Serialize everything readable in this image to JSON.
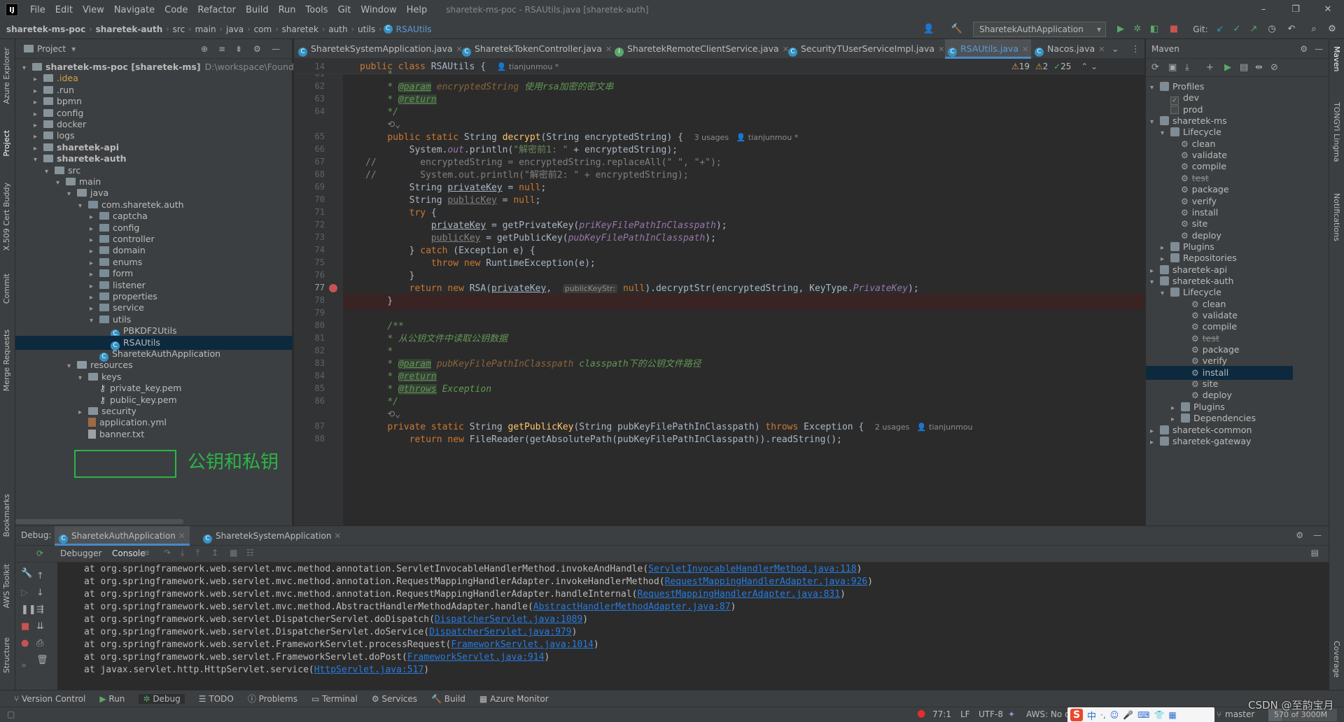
{
  "menubar": {
    "items": [
      "File",
      "Edit",
      "View",
      "Navigate",
      "Code",
      "Refactor",
      "Build",
      "Run",
      "Tools",
      "Git",
      "Window",
      "Help"
    ],
    "title": "sharetek-ms-poc - RSAUtils.java [sharetek-auth]"
  },
  "navbar": {
    "breadcrumbs": [
      "sharetek-ms-poc",
      "sharetek-auth",
      "src",
      "main",
      "java",
      "com",
      "sharetek",
      "auth",
      "utils",
      "RSAUtils"
    ],
    "run_config": "SharetekAuthApplication",
    "git_label": "Git:"
  },
  "left_strip": [
    "Azure Explorer",
    "Project",
    "X.509 Cert Buddy",
    "Commit",
    "Merge Requests",
    "Bookmarks",
    "AWS Toolkit",
    "Structure"
  ],
  "right_strip": [
    "Maven",
    "TONGYI Lingma",
    "Notifications",
    "Coverage"
  ],
  "project": {
    "header": "Project",
    "rows": [
      {
        "label": "sharetek-ms-poc [sharetek-ms]",
        "extra": "D:\\workspace\\Foundation\\s",
        "kind": "folder",
        "bold": true,
        "arrow": "▾"
      },
      {
        "label": ".idea",
        "kind": "folder",
        "arrow": "▸",
        "color": "#d0a248"
      },
      {
        "label": ".run",
        "kind": "folder",
        "arrow": "▸"
      },
      {
        "label": "bpmn",
        "kind": "folder",
        "arrow": "▸"
      },
      {
        "label": "config",
        "kind": "folder",
        "arrow": "▸"
      },
      {
        "label": "docker",
        "kind": "folder",
        "arrow": "▸"
      },
      {
        "label": "logs",
        "kind": "folder",
        "arrow": "▸"
      },
      {
        "label": "sharetek-api",
        "kind": "folder",
        "arrow": "▸",
        "bold": true
      },
      {
        "label": "sharetek-auth",
        "kind": "folder",
        "arrow": "▾",
        "bold": true
      },
      {
        "label": "src",
        "kind": "folder",
        "arrow": "▾"
      },
      {
        "label": "main",
        "kind": "folder",
        "arrow": "▾"
      },
      {
        "label": "java",
        "kind": "folder",
        "arrow": "▾"
      },
      {
        "label": "com.sharetek.auth",
        "kind": "pkg",
        "arrow": "▾"
      },
      {
        "label": "captcha",
        "kind": "pkg",
        "arrow": "▸"
      },
      {
        "label": "config",
        "kind": "pkg",
        "arrow": "▸"
      },
      {
        "label": "controller",
        "kind": "pkg",
        "arrow": "▸"
      },
      {
        "label": "domain",
        "kind": "pkg",
        "arrow": "▸"
      },
      {
        "label": "enums",
        "kind": "pkg",
        "arrow": "▸"
      },
      {
        "label": "form",
        "kind": "pkg",
        "arrow": "▸"
      },
      {
        "label": "listener",
        "kind": "pkg",
        "arrow": "▸"
      },
      {
        "label": "properties",
        "kind": "pkg",
        "arrow": "▸"
      },
      {
        "label": "service",
        "kind": "pkg",
        "arrow": "▸"
      },
      {
        "label": "utils",
        "kind": "pkg",
        "arrow": "▾"
      },
      {
        "label": "PBKDF2Utils",
        "kind": "java",
        "arrow": ""
      },
      {
        "label": "RSAUtils",
        "kind": "java",
        "arrow": "",
        "selected": true
      },
      {
        "label": "SharetekAuthApplication",
        "kind": "java",
        "arrow": ""
      },
      {
        "label": "resources",
        "kind": "res",
        "arrow": "▾"
      },
      {
        "label": "keys",
        "kind": "folder",
        "arrow": "▾"
      },
      {
        "label": "private_key.pem",
        "kind": "key",
        "arrow": ""
      },
      {
        "label": "public_key.pem",
        "kind": "key",
        "arrow": ""
      },
      {
        "label": "security",
        "kind": "folder",
        "arrow": "▸"
      },
      {
        "label": "application.yml",
        "kind": "yml",
        "arrow": ""
      },
      {
        "label": "banner.txt",
        "kind": "txt",
        "arrow": ""
      }
    ],
    "annotation": "公钥和私钥"
  },
  "editor": {
    "tabs": [
      {
        "label": "SharetekSystemApplication.java",
        "active": false
      },
      {
        "label": "SharetekTokenController.java",
        "active": false
      },
      {
        "label": "SharetekRemoteClientService.java",
        "active": false
      },
      {
        "label": "SecurityTUserServiceImpl.java",
        "active": false
      },
      {
        "label": "RSAUtils.java",
        "active": true
      },
      {
        "label": "Nacos.java",
        "active": false
      }
    ],
    "sticky": {
      "line": "14",
      "author": "tianjunmou *"
    },
    "inspections": {
      "warnings": "19",
      "weak": "2",
      "ok": "25"
    },
    "line_numbers": [
      "61",
      "62",
      "63",
      "64",
      "",
      "65",
      "66",
      "67",
      "68",
      "69",
      "70",
      "71",
      "72",
      "73",
      "74",
      "75",
      "76",
      "77",
      "78",
      "79",
      "80",
      "81",
      "82",
      "83",
      "84",
      "85",
      "86",
      "",
      "87",
      "88"
    ],
    "usages_65": "3 usages",
    "author_65": "tianjunmou *",
    "usages_87": "2 usages",
    "author_87": "tianjunmou",
    "inlay_hint": "publicKeyStr:"
  },
  "maven": {
    "header": "Maven",
    "rows": [
      {
        "label": "Profiles",
        "kind": "mvn",
        "arrow": "▾",
        "indent": 0
      },
      {
        "label": "dev",
        "kind": "check",
        "checked": true,
        "indent": 1
      },
      {
        "label": "prod",
        "kind": "check",
        "checked": false,
        "indent": 1
      },
      {
        "label": "sharetek-ms",
        "kind": "mvn",
        "arrow": "▾",
        "indent": 0
      },
      {
        "label": "Lifecycle",
        "kind": "mvn",
        "arrow": "▾",
        "indent": 1
      },
      {
        "label": "clean",
        "kind": "gear",
        "indent": 2
      },
      {
        "label": "validate",
        "kind": "gear",
        "indent": 2
      },
      {
        "label": "compile",
        "kind": "gear",
        "indent": 2
      },
      {
        "label": "test",
        "kind": "gear",
        "indent": 2,
        "strike": true
      },
      {
        "label": "package",
        "kind": "gear",
        "indent": 2
      },
      {
        "label": "verify",
        "kind": "gear",
        "indent": 2
      },
      {
        "label": "install",
        "kind": "gear",
        "indent": 2
      },
      {
        "label": "site",
        "kind": "gear",
        "indent": 2
      },
      {
        "label": "deploy",
        "kind": "gear",
        "indent": 2
      },
      {
        "label": "Plugins",
        "kind": "mvn",
        "arrow": "▸",
        "indent": 1
      },
      {
        "label": "Repositories",
        "kind": "mvn",
        "arrow": "▸",
        "indent": 1
      },
      {
        "label": "sharetek-api",
        "kind": "mvn",
        "arrow": "▸",
        "indent": 0
      },
      {
        "label": "sharetek-auth",
        "kind": "mvn",
        "arrow": "▾",
        "indent": 0
      },
      {
        "label": "Lifecycle",
        "kind": "mvn",
        "arrow": "▾",
        "indent": 1
      },
      {
        "label": "clean",
        "kind": "gear",
        "indent": 3
      },
      {
        "label": "validate",
        "kind": "gear",
        "indent": 3
      },
      {
        "label": "compile",
        "kind": "gear",
        "indent": 3
      },
      {
        "label": "test",
        "kind": "gear",
        "indent": 3,
        "strike": true
      },
      {
        "label": "package",
        "kind": "gear",
        "indent": 3
      },
      {
        "label": "verify",
        "kind": "gear",
        "indent": 3
      },
      {
        "label": "install",
        "kind": "gear",
        "indent": 3,
        "selected": true
      },
      {
        "label": "site",
        "kind": "gear",
        "indent": 3
      },
      {
        "label": "deploy",
        "kind": "gear",
        "indent": 3
      },
      {
        "label": "Plugins",
        "kind": "mvn",
        "arrow": "▸",
        "indent": 2
      },
      {
        "label": "Dependencies",
        "kind": "mvn",
        "arrow": "▸",
        "indent": 2
      },
      {
        "label": "sharetek-common",
        "kind": "mvn",
        "arrow": "▸",
        "indent": 0
      },
      {
        "label": "sharetek-gateway",
        "kind": "mvn",
        "arrow": "▸",
        "indent": 0
      }
    ]
  },
  "debug": {
    "label": "Debug:",
    "sessions": [
      "SharetekAuthApplication",
      "SharetekSystemApplication"
    ],
    "subtabs": [
      "Debugger",
      "Console"
    ],
    "trace": [
      {
        "text": "at org.springframework.web.servlet.mvc.method.annotation.ServletInvocableHandlerMethod.invokeAndHandle(",
        "link": "ServletInvocableHandlerMethod.java:118",
        "tail": ")"
      },
      {
        "text": "at org.springframework.web.servlet.mvc.method.annotation.RequestMappingHandlerAdapter.invokeHandlerMethod(",
        "link": "RequestMappingHandlerAdapter.java:926",
        "tail": ")"
      },
      {
        "text": "at org.springframework.web.servlet.mvc.method.annotation.RequestMappingHandlerAdapter.handleInternal(",
        "link": "RequestMappingHandlerAdapter.java:831",
        "tail": ")"
      },
      {
        "text": "at org.springframework.web.servlet.mvc.method.AbstractHandlerMethodAdapter.handle(",
        "link": "AbstractHandlerMethodAdapter.java:87",
        "tail": ")"
      },
      {
        "text": "at org.springframework.web.servlet.DispatcherServlet.doDispatch(",
        "link": "DispatcherServlet.java:1089",
        "tail": ")"
      },
      {
        "text": "at org.springframework.web.servlet.DispatcherServlet.doService(",
        "link": "DispatcherServlet.java:979",
        "tail": ")"
      },
      {
        "text": "at org.springframework.web.servlet.FrameworkServlet.processRequest(",
        "link": "FrameworkServlet.java:1014",
        "tail": ")"
      },
      {
        "text": "at org.springframework.web.servlet.FrameworkServlet.doPost(",
        "link": "FrameworkServlet.java:914",
        "tail": ")"
      },
      {
        "text": "at javax.servlet.http.HttpServlet.service(",
        "link": "HttpServlet.java:517",
        "tail": ")"
      }
    ]
  },
  "toolwindows": [
    "Version Control",
    "Run",
    "Debug",
    "TODO",
    "Problems",
    "Terminal",
    "Services",
    "Build",
    "Azure Monitor"
  ],
  "status": {
    "position": "77:1",
    "line_sep": "LF",
    "encoding": "UTF-8",
    "aws": "AWS: No c",
    "branch": "master",
    "memory": "570 of 3000M",
    "watermark": "CSDN @至韵宝月"
  }
}
